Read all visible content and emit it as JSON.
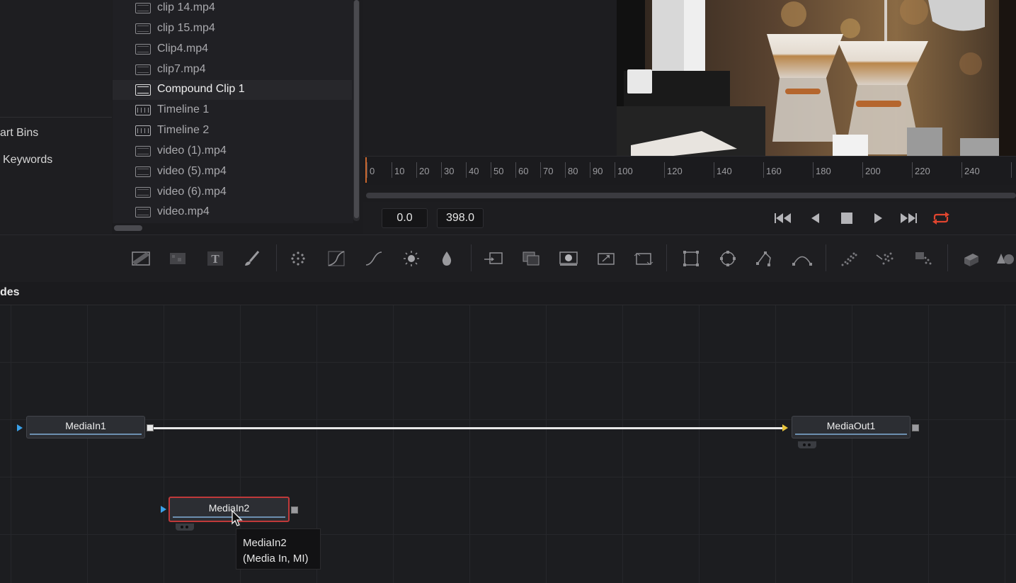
{
  "sidebar": {
    "items": [
      {
        "label": "art Bins"
      },
      {
        "label": "Keywords"
      }
    ]
  },
  "media_pool": {
    "clips": [
      {
        "name": "clip 14.mp4",
        "kind": "video"
      },
      {
        "name": "clip 15.mp4",
        "kind": "video"
      },
      {
        "name": "Clip4.mp4",
        "kind": "video"
      },
      {
        "name": "clip7.mp4",
        "kind": "video"
      },
      {
        "name": "Compound Clip 1",
        "kind": "compound",
        "selected": true
      },
      {
        "name": "Timeline 1",
        "kind": "timeline"
      },
      {
        "name": "Timeline 2",
        "kind": "timeline"
      },
      {
        "name": "video (1).mp4",
        "kind": "video"
      },
      {
        "name": "video (5).mp4",
        "kind": "video"
      },
      {
        "name": "video (6).mp4",
        "kind": "video"
      },
      {
        "name": "video.mp4",
        "kind": "video"
      }
    ]
  },
  "ruler": {
    "labels": [
      "0",
      "10",
      "20",
      "30",
      "40",
      "50",
      "60",
      "70",
      "80",
      "90",
      "100",
      "120",
      "140",
      "160",
      "180",
      "200",
      "220",
      "240"
    ]
  },
  "transport": {
    "start_time": "0.0",
    "end_time": "398.0",
    "buttons": [
      "skip-to-start-icon",
      "play-reverse-icon",
      "stop-icon",
      "play-icon",
      "skip-to-end-icon",
      "loop-icon"
    ],
    "loop_color": "#e0452f"
  },
  "toolbar": {
    "tools": [
      "background-icon",
      "fast-noise-icon",
      "text-icon",
      "paint-icon",
      "particles-icon",
      "color-curves-icon",
      "brightness-contrast-icon",
      "color-corrector-icon",
      "blur-icon",
      "merge-icon",
      "channel-booleans-icon",
      "matte-control-icon",
      "resize-icon",
      "transform-icon",
      "rectangle-mask-icon",
      "ellipse-mask-icon",
      "polygon-mask-icon",
      "bspline-mask-icon",
      "pemitter-icon",
      "prender-icon",
      "pimage-icon",
      "shape3d-icon",
      "renderer3d-icon"
    ]
  },
  "nodes_panel": {
    "title": "des"
  },
  "nodes": [
    {
      "label": "MediaIn1",
      "selected": false
    },
    {
      "label": "MediaOut1",
      "selected": false
    },
    {
      "label": "MediaIn2",
      "selected": true
    }
  ],
  "tooltip": {
    "line1": "MediaIn2",
    "line2": "(Media In, MI)"
  },
  "colors": {
    "accent_blue": "#3aa0e8",
    "accent_yellow": "#e8c43a",
    "selection_red": "#c0393a",
    "playhead": "#c9662d"
  }
}
